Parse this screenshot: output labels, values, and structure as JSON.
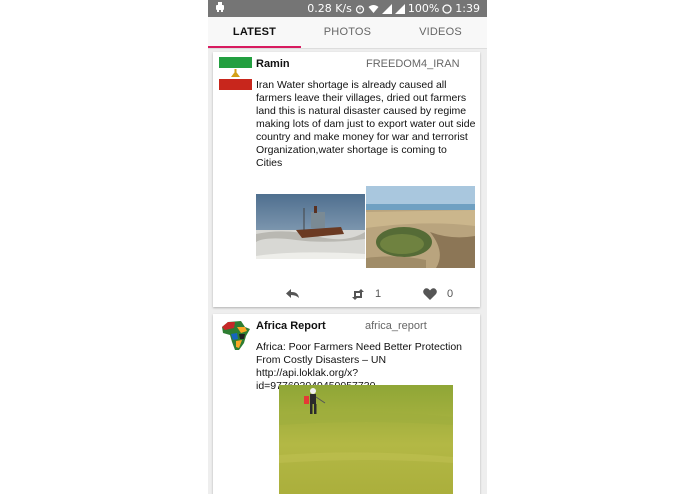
{
  "status_bar": {
    "left_icon": "usb-debug-icon",
    "network_speed": "0.28 K/s",
    "battery": "100%",
    "time": "1:39"
  },
  "tabs": [
    {
      "label": "LATEST",
      "active": true
    },
    {
      "label": "PHOTOS",
      "active": false
    },
    {
      "label": "VIDEOS",
      "active": false
    }
  ],
  "tweets": [
    {
      "name": "Ramin",
      "handle": "FREEDOM4_IRAN",
      "text": "Iran Water shortage is already caused all farmers leave their villages, dried out farmers land this is natural disaster caused by regime making lots of dam just to export water out side country and make money for war and terrorist Organization,water shortage is coming to Cities",
      "avatar_icon": "iran-flag-avatar",
      "media": [
        "stranded-ship-photo",
        "dry-lake-photo"
      ],
      "retweets": "1",
      "likes": "0"
    },
    {
      "name": "Africa Report",
      "handle": "africa_report",
      "text": "Africa: Poor Farmers Need Better Protection From Costly Disasters – UN http://api.loklak.org/x?id=977693049450057730",
      "avatar_icon": "africa-map-avatar",
      "media": [
        "farmer-field-photo"
      ]
    }
  ],
  "colors": {
    "accent": "#d81b60",
    "status_bar": "#757575",
    "background": "#eeeeee"
  }
}
